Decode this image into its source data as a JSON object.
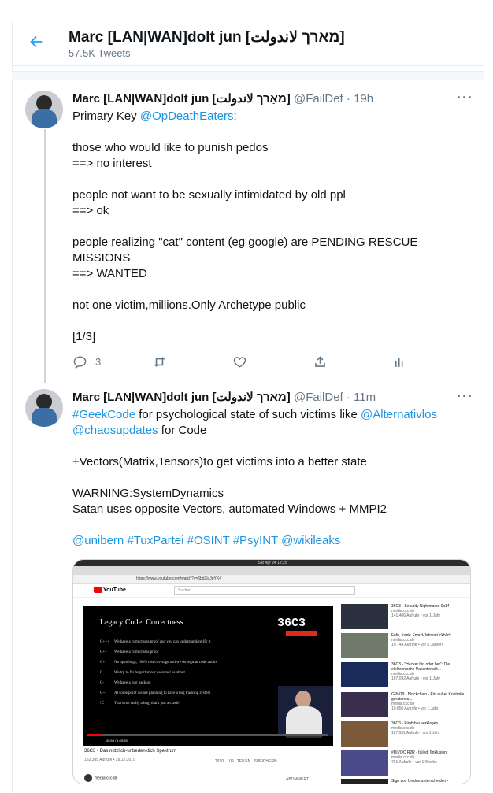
{
  "header": {
    "name": "Marc [LAN|WAN]dolt jun [מאַרך لاندولت]",
    "tweet_count": "57.5K Tweets"
  },
  "tweets": [
    {
      "name": "Marc [LAN|WAN]dolt jun [מאַרך لاندولت]",
      "handle": "@FailDef",
      "time": "· 19h",
      "lines": {
        "l1": "Primary Key ",
        "l1_link": "@OpDeathEaters",
        "l1_end": ":",
        "l2": "those who would like to punish pedos",
        "l3": "==> no interest",
        "l4": "people not want to be sexually intimidated by old ppl",
        "l5": "==> ok",
        "l6": "people realizing \"cat\" content (eg google) are PENDING RESCUE",
        "l7": "MISSIONS",
        "l8": "==> WANTED",
        "l9": "not one victim,millions.Only Archetype public",
        "l10": "[1/3]"
      },
      "reply_count": "3"
    },
    {
      "name": "Marc [LAN|WAN]dolt jun [מאַרך لاندولت]",
      "handle": "@FailDef",
      "time": "· 11m",
      "lines": {
        "l1_link_a": "#GeekCode",
        "l1_mid": " for psychological state of such victims like ",
        "l1_link_b": "@Alternativlos",
        "l2_link": "@chaosupdates",
        "l2_end": " for Code",
        "l3": "+Vectors(Matrix,Tensors)to get victims into a better state",
        "l4": "WARNING:SystemDynamics",
        "l5": "Satan uses opposite Vectors, automated Windows + MMPI2",
        "l6_a": "@unibern",
        "l6_b": "#TuxPartei",
        "l6_c": "#OSINT",
        "l6_d": "#PsyINT",
        "l6_e": "@wikileaks"
      }
    }
  ],
  "media": {
    "clock": "Sat Apr 24 12:25",
    "url": "https://www.youtube.com/watch?v=6bd2lgJpYK4",
    "yt_logo": "YouTube",
    "search_placeholder": "Suchen",
    "slide": {
      "title": "Legacy Code: Correctness",
      "logo": "36C3",
      "rows": [
        {
          "k": "C+++",
          "t": "We have a correctness proof and you can understand/verify it"
        },
        {
          "k": "C++",
          "t": "We have a correctness proof"
        },
        {
          "k": "C+",
          "t": "No open bugs, 100% test coverage and we do regular code audits"
        },
        {
          "k": "C",
          "t": "We try to fix bugs that our users tell us about"
        },
        {
          "k": "C-",
          "t": "We have a bug backlog"
        },
        {
          "k": "C--",
          "t": "At some point we are planning to have a bug tracking system"
        },
        {
          "k": "!C",
          "t": "That's not really a bug, that's just a crash!"
        }
      ]
    },
    "time_readout": "45:59 / 1:03:39",
    "progress": 0.06,
    "video_title": "36C3 - Das nützlich-unbedenklich Spektrum",
    "video_meta": "182.385 Aufrufe • 29.12.2019",
    "likes": "2510",
    "dislikes": "109",
    "share": "TEILEN",
    "save": "SPEICHERN",
    "channel": "media.ccc.de",
    "subscribe": "ABONNIERT",
    "sidebar": [
      {
        "title": "36C3 - Security Nightmares 0x14",
        "chan": "media.ccc.de",
        "meta": "141.406 Aufrufe • vor 1 Jahr"
      },
      {
        "title": "Fefe, frank: Fnord-Jahresrückblick",
        "chan": "media.ccc.de",
        "meta": "10.744 Aufrufe • vor 5 Jahren"
      },
      {
        "title": "36C3 - \"Hacker hin oder her\": Die elektronische Patientenakt...",
        "chan": "media.ccc.de",
        "meta": "107.092 Aufrufe • vor 1 Jahr"
      },
      {
        "title": "GPN19 - Blockchain - Ein außer Kontrolle geratenes...",
        "chan": "media.ccc.de",
        "meta": "10.850 Aufrufe • vor 1 Jahr"
      },
      {
        "title": "36C3 - Fünfsher verklagen",
        "chan": "media.ccc.de",
        "meta": "117.931 Aufrufe • vor 1 Jahr"
      },
      {
        "title": "#DiVOC R2R - failed: [Inklusion]",
        "chan": "media.ccc.de",
        "meta": "761 Aufrufe • vor 1 Woche"
      },
      {
        "title": "Sign von Unsinn unterscheiden -",
        "chan": "",
        "meta": ""
      }
    ]
  }
}
